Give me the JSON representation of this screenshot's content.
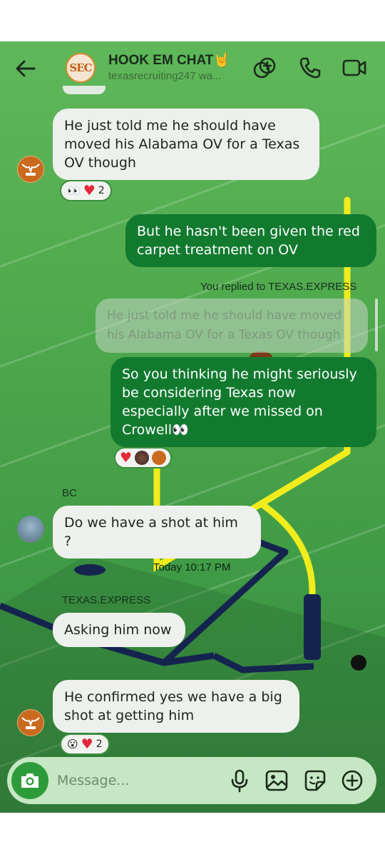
{
  "header": {
    "group_avatar_text": "SEC",
    "title": "HOOK EM CHAT🤘",
    "subtitle": "texasrecruiting247 wa...",
    "icons": [
      "back-arrow-icon",
      "add-effects-icon",
      "phone-icon",
      "video-camera-icon"
    ]
  },
  "messages": [
    {
      "id": "m1",
      "text": "He just told me he should have moved his Alabama OV for a Texas OV though",
      "reactions": {
        "emojis": [
          "👀",
          "❤️"
        ],
        "count": "2"
      }
    },
    {
      "id": "m2",
      "text": "But he hasn't been given the red carpet treatment on OV"
    },
    {
      "id": "m3",
      "reply_label": "You replied to TEXAS.EXPRESS",
      "quoted": "He just told me he should have moved his Alabama OV for a Texas OV though",
      "text": "So you thinking he might seriously be considering Texas now especially after we missed on Crowell👀"
    },
    {
      "id": "m4",
      "sender": "BC",
      "text": "Do we have a shot at him ?"
    },
    {
      "id": "m5",
      "timestamp": "Today 10:17 PM",
      "sender": "TEXAS.EXPRESS",
      "text": "Asking him now"
    },
    {
      "id": "m6",
      "text": "He confirmed yes we have a big shot at getting him",
      "reactions": {
        "emojis": [
          "😮",
          "❤️"
        ],
        "count": "2"
      }
    }
  ],
  "composer": {
    "placeholder": "Message...",
    "icons": [
      "camera-icon",
      "microphone-icon",
      "gallery-icon",
      "sticker-icon",
      "plus-icon"
    ]
  },
  "colors": {
    "outgoing": "#127a2f",
    "incoming": "#eef0ed",
    "accent": "#2e9b3a",
    "reaction_border": "#3c8f3f"
  }
}
